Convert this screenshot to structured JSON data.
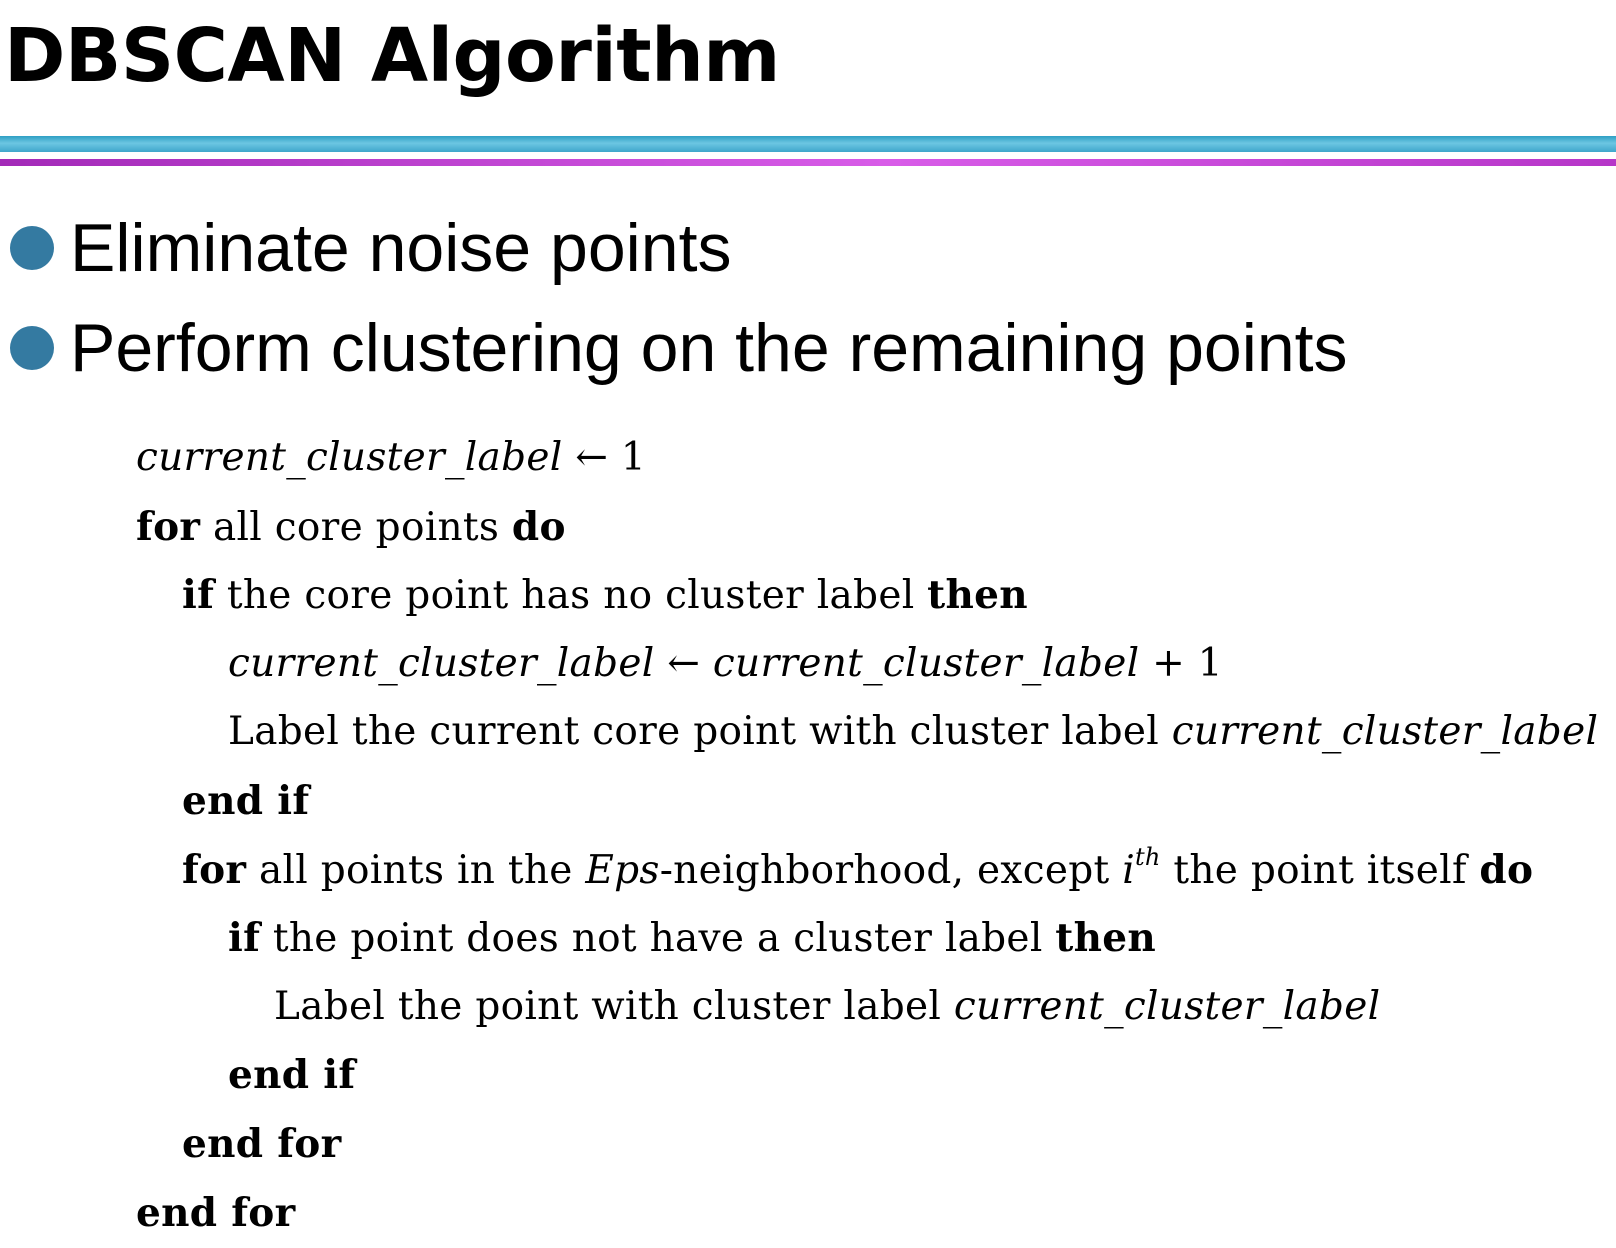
{
  "title": "DBSCAN Algorithm",
  "bullets": [
    "Eliminate noise points",
    "Perform clustering on the remaining points"
  ],
  "algorithm": {
    "l1": {
      "var": "current_cluster_label",
      "rest": " ← 1"
    },
    "l2": {
      "kw1": "for",
      "text": " all core points ",
      "kw2": "do"
    },
    "l3": {
      "kw1": "if",
      "text": " the core point has no cluster label ",
      "kw2": "then"
    },
    "l4": {
      "var1": "current_cluster_label",
      "op": " ← ",
      "var2": "current_cluster_label",
      "rest": " + 1"
    },
    "l5": {
      "text": "Label the current core point with cluster label ",
      "var": "current_cluster_label"
    },
    "l6": {
      "kw": "end if"
    },
    "l7": {
      "kw1": "for",
      "text1": " all points in the ",
      "var": "Eps",
      "text2": "-neighborhood, except ",
      "ivar": "i",
      "sup": "th",
      "text3": " the point itself ",
      "kw2": "do"
    },
    "l8": {
      "kw1": "if",
      "text": " the point does not have a cluster label ",
      "kw2": "then"
    },
    "l9": {
      "text": "Label the point with cluster label ",
      "var": "current_cluster_label"
    },
    "l10": {
      "kw": "end if"
    },
    "l11": {
      "kw": "end for"
    },
    "l12": {
      "kw": "end for"
    }
  },
  "colors": {
    "bullet": "#347aa1",
    "rule_blue": "#3fa6cb",
    "rule_purple": "#c245d4"
  }
}
